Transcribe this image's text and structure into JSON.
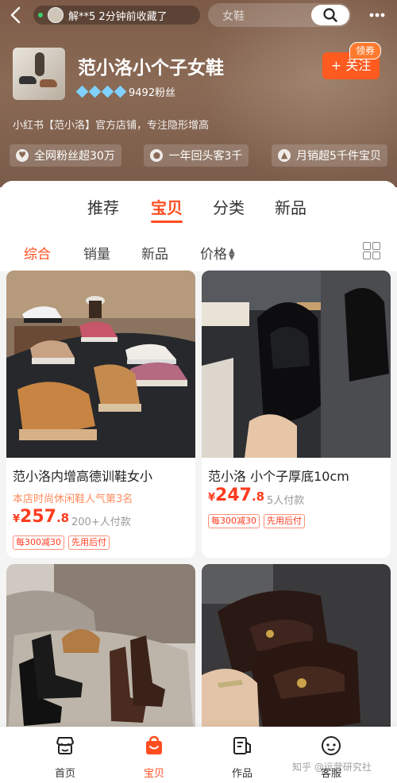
{
  "topbar": {
    "back_icon": "back-arrow-icon",
    "visitor_notice": "解**5 2分钟前收藏了",
    "search_placeholder": "女鞋",
    "search_icon": "search-icon",
    "more_icon": "more-dots-icon"
  },
  "store": {
    "name": "范小洛小个子女鞋",
    "fans": "9492粉丝",
    "level_diamonds": 4,
    "coupon_tag": "领券",
    "follow_label": "+ 关注",
    "description": "小红书【范小洛】官方店铺，专注隐形增高",
    "chips": [
      {
        "icon": "heart-icon",
        "label": "全网粉丝超30万"
      },
      {
        "icon": "user-icon",
        "label": "一年回头客3千"
      },
      {
        "icon": "fire-icon",
        "label": "月销超5千件宝贝"
      }
    ]
  },
  "tabs": [
    "推荐",
    "宝贝",
    "分类",
    "新品"
  ],
  "active_tab": "宝贝",
  "sort": {
    "items": [
      "综合",
      "销量",
      "新品",
      "价格"
    ],
    "active": "综合",
    "layout_icon": "grid-view-icon"
  },
  "products": [
    {
      "title": "范小洛内增高德训鞋女小",
      "subtitle": "本店时尚休闲鞋人气第3名",
      "price_currency": "¥",
      "price_int": "257",
      "price_dec": ".8",
      "sold": "200+人付款",
      "tags": [
        "每300减30",
        "先用后付"
      ]
    },
    {
      "title": "范小洛 小个子厚底10cm",
      "subtitle": "",
      "price_currency": "¥",
      "price_int": "247",
      "price_dec": ".8",
      "sold": "5人付款",
      "tags": [
        "每300减30",
        "先用后付"
      ]
    },
    {
      "title": "",
      "subtitle": "",
      "price_currency": "",
      "price_int": "",
      "price_dec": "",
      "sold": "",
      "tags": []
    },
    {
      "title": "",
      "subtitle": "",
      "price_currency": "",
      "price_int": "",
      "price_dec": "",
      "sold": "",
      "tags": []
    }
  ],
  "bottom_nav": [
    {
      "icon": "store-icon",
      "label": "首页"
    },
    {
      "icon": "shopping-bag-icon",
      "label": "宝贝"
    },
    {
      "icon": "article-icon",
      "label": "作品"
    },
    {
      "icon": "customer-service-icon",
      "label": "客服"
    }
  ],
  "bottom_nav_active": "宝贝",
  "watermark": "知乎 @运营研究社",
  "colors": {
    "accent": "#ff4d1f",
    "price": "#ff3b1f",
    "header_bg": "#7d5b48",
    "follow": "#ff5a1f"
  }
}
